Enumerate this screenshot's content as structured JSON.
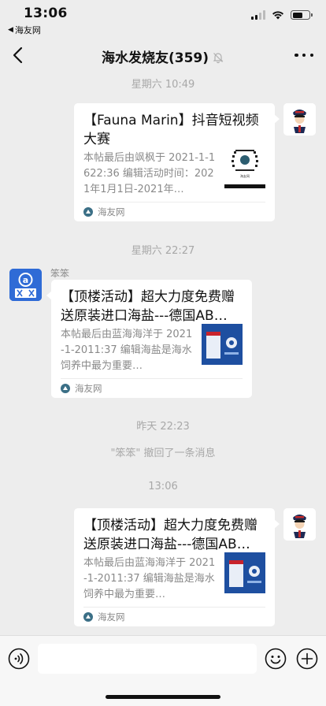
{
  "status_bar": {
    "time": "13:06",
    "back_app": "海友网",
    "battery_level": 0.6
  },
  "nav": {
    "title": "海水发烧友(359)",
    "muted": true
  },
  "messages": [
    {
      "timestamp": "星期六 10:49",
      "side": "right",
      "card": {
        "title": "【Fauna Marin】抖音短视频大赛",
        "desc": "本帖最后由飒枫于 2021-1-1622:36 编辑活动时间：2021年1月1日-2021年…",
        "source": "海友网",
        "thumb": "qr-code"
      }
    },
    {
      "timestamp": "星期六 22:27",
      "side": "left",
      "sender": "笨笨",
      "card": {
        "title": "【顶楼活动】超大力度免费赠送原装进口海盐---德国AB…",
        "desc": "本帖最后由蓝海海洋于 2021-1-2011:37 编辑海盐是海水饲养中最为重要…",
        "source": "海友网",
        "thumb": "salt-box"
      }
    },
    {
      "timestamp": "昨天 22:23",
      "system": "\"笨笨\" 撤回了一条消息"
    },
    {
      "timestamp": "13:06",
      "side": "right",
      "card": {
        "title": "【顶楼活动】超大力度免费赠送原装进口海盐---德国AB…",
        "desc": "本帖最后由蓝海海洋于 2021-1-2011:37 编辑海盐是海水饲养中最为重要…",
        "source": "海友网",
        "thumb": "salt-box"
      }
    }
  ],
  "input_bar": {
    "value": "",
    "placeholder": ""
  },
  "colors": {
    "background": "#ededed",
    "bubble": "#ffffff",
    "meta_text": "#a8a8a8",
    "source_icon": "#3b6f86"
  }
}
